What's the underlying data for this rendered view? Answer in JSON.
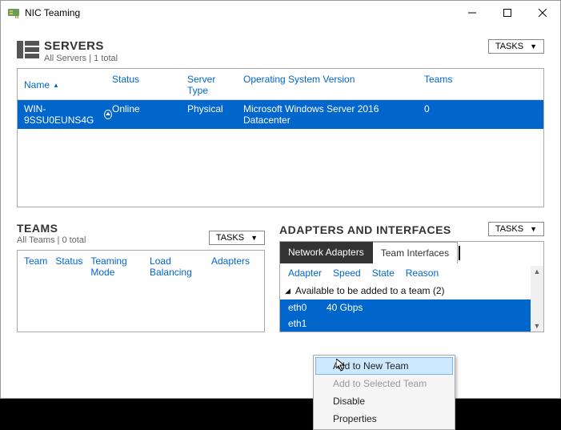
{
  "window": {
    "title": "NIC Teaming"
  },
  "servers": {
    "title": "SERVERS",
    "subtitle": "All Servers | 1 total",
    "tasks_label": "TASKS",
    "columns": {
      "name": "Name",
      "status": "Status",
      "type": "Server Type",
      "os": "Operating System Version",
      "teams": "Teams"
    },
    "row": {
      "name": "WIN-9SSU0EUNS4G",
      "status": "Online",
      "type": "Physical",
      "os": "Microsoft Windows Server 2016 Datacenter",
      "teams": "0"
    }
  },
  "teams": {
    "title": "TEAMS",
    "subtitle": "All Teams | 0 total",
    "tasks_label": "TASKS",
    "columns": {
      "team": "Team",
      "status": "Status",
      "mode": "Teaming Mode",
      "lb": "Load Balancing",
      "adapters": "Adapters"
    }
  },
  "adapters": {
    "title": "ADAPTERS AND INTERFACES",
    "tasks_label": "TASKS",
    "tabs": {
      "net": "Network Adapters",
      "team": "Team Interfaces"
    },
    "columns": {
      "adapter": "Adapter",
      "speed": "Speed",
      "state": "State",
      "reason": "Reason"
    },
    "group": "Available to be added to a team (2)",
    "rows": [
      {
        "name": "eth0",
        "speed": "40 Gbps"
      },
      {
        "name": "eth1",
        "speed": ""
      }
    ]
  },
  "context_menu": {
    "add_new": "Add to New Team",
    "add_sel": "Add to Selected Team",
    "disable": "Disable",
    "props": "Properties"
  }
}
